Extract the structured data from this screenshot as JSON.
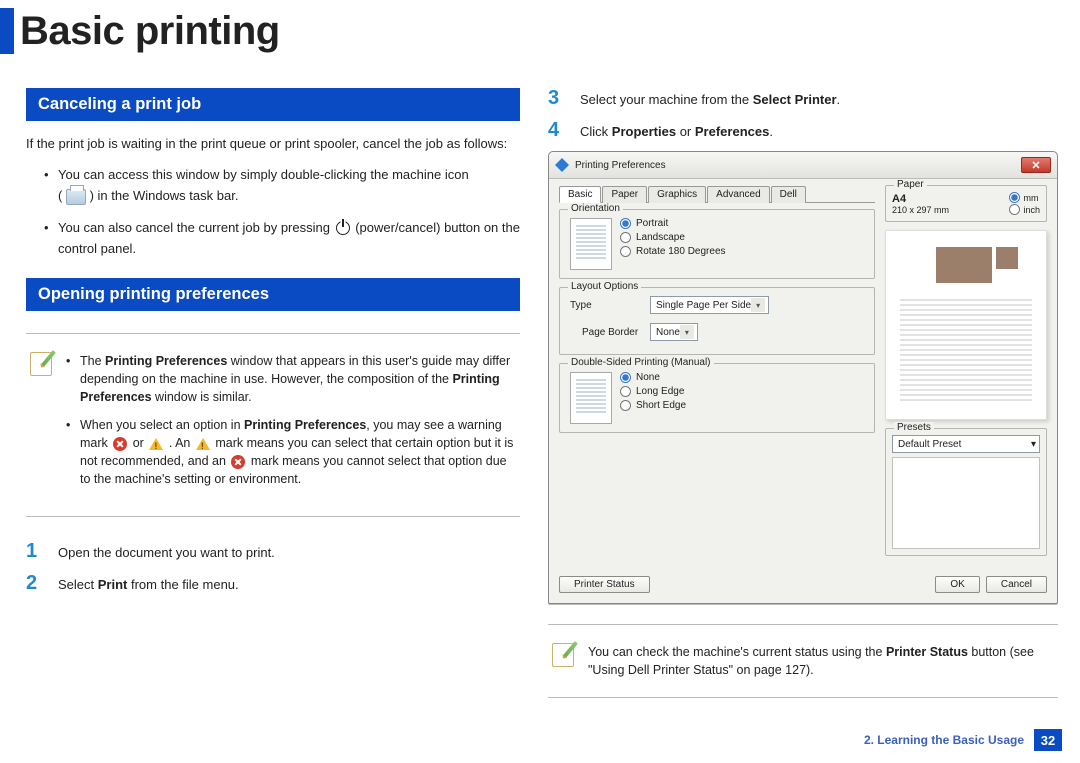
{
  "page_title": "Basic printing",
  "left": {
    "sec1_title": "Canceling a print job",
    "sec1_intro": "If the print job is waiting in the print queue or print spooler, cancel the job as follows:",
    "sec1_b1a": "You can access this window by simply double-clicking the machine icon",
    "sec1_b1b": "(",
    "sec1_b1c": ") in the Windows task bar.",
    "sec1_b2a": "You can also cancel the current job by pressing ",
    "sec1_b2b": "(power/cancel) button on the control panel.",
    "sec2_title": "Opening printing preferences",
    "note1a": "The ",
    "note1b_bold": "Printing Preferences",
    "note1c": " window that appears in this user's guide may differ depending on the machine in use. However, the composition of the ",
    "note1d_bold": "Printing Preferences",
    "note1e": " window is similar.",
    "note2a": "When you select an option in ",
    "note2b_bold": "Printing Preferences",
    "note2c": ", you may see a warning mark ",
    "note2d": " or ",
    "note2e": ". An ",
    "note2f": " mark means you can select that certain option but it is not recommended, and an ",
    "note2g": " mark means you cannot select that option due to the machine's setting or environment.",
    "step1_num": "1",
    "step1_text": "Open the document you want to print.",
    "step2_num": "2",
    "step2a": "Select ",
    "step2b_bold": "Print",
    "step2c": " from the file menu."
  },
  "right": {
    "step3_num": "3",
    "step3a": "Select your machine from the ",
    "step3b_bold": "Select Printer",
    "step3c": ".",
    "step4_num": "4",
    "step4a": "Click ",
    "step4b_bold": "Properties",
    "step4c": " or ",
    "step4d_bold": "Preferences",
    "step4e": ".",
    "note2a": "You can check the machine's current status using the ",
    "note2b_bold": "Printer Status",
    "note2c": " button (see \"Using Dell Printer Status\" on page 127)."
  },
  "dialog": {
    "title": "Printing Preferences",
    "tabs": [
      "Basic",
      "Paper",
      "Graphics",
      "Advanced",
      "Dell"
    ],
    "orientation": {
      "legend": "Orientation",
      "opts": [
        "Portrait",
        "Landscape",
        "Rotate 180 Degrees"
      ]
    },
    "layout": {
      "legend": "Layout Options",
      "type_label": "Type",
      "type_value": "Single Page Per Side",
      "border_label": "Page Border",
      "border_value": "None"
    },
    "duplex": {
      "legend": "Double-Sided Printing (Manual)",
      "opts": [
        "None",
        "Long Edge",
        "Short Edge"
      ]
    },
    "paper": {
      "legend": "Paper",
      "name": "A4",
      "dim": "210 x 297 mm",
      "units": [
        "mm",
        "inch"
      ]
    },
    "presets": {
      "legend": "Presets",
      "value": "Default Preset"
    },
    "footer": {
      "status": "Printer Status",
      "ok": "OK",
      "cancel": "Cancel"
    }
  },
  "footer": {
    "chapter": "2. Learning the Basic Usage",
    "page": "32"
  }
}
